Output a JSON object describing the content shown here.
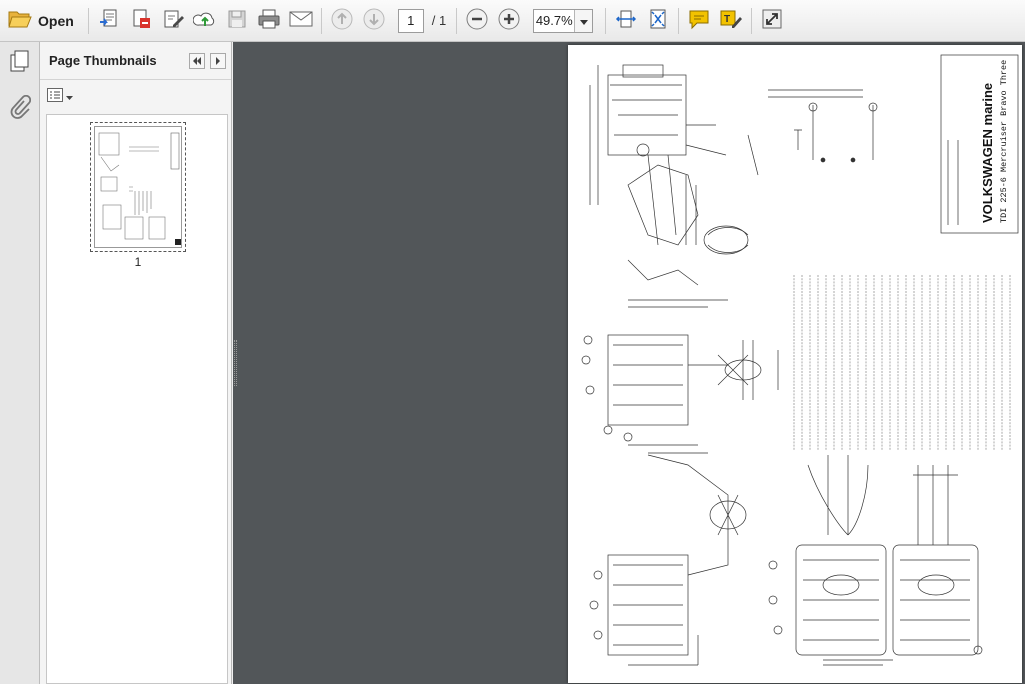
{
  "toolbar": {
    "open_label": "Open",
    "page_current": "1",
    "page_total": "/ 1",
    "zoom_value": "49.7%"
  },
  "sidebar": {
    "panel_title": "Page Thumbnails",
    "thumbnails": [
      {
        "page_label": "1"
      }
    ]
  },
  "document": {
    "brand": "VOLKSWAGEN marine",
    "model": "TDI 225-6 Mercruiser Bravo Three"
  },
  "colors": {
    "document_background": "#525659",
    "toolbar_background": "#ececec",
    "page_background": "#ffffff",
    "comment_icon": "#f2c200",
    "navigation_icon": "#1c66c9"
  },
  "icons": [
    "folder-open-icon",
    "create-pdf-icon",
    "pdf-tools-icon",
    "edit-icon",
    "upload-cloud-icon",
    "save-icon",
    "print-icon",
    "email-icon",
    "prev-page-icon",
    "next-page-icon",
    "zoom-out-icon",
    "zoom-in-icon",
    "fit-width-icon",
    "fit-page-icon",
    "comment-icon",
    "highlight-icon",
    "fullscreen-icon",
    "pages-panel-icon",
    "attachment-icon",
    "options-menu-icon"
  ]
}
